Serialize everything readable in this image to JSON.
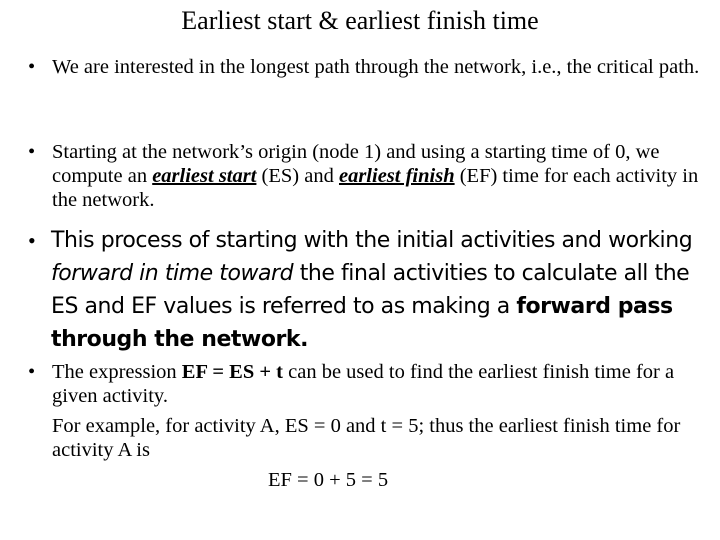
{
  "slide": {
    "title": "Earliest start & earliest finish time",
    "bullet_glyph": "•",
    "bullets": [
      {
        "text": "We are interested in the longest path through the network, i.e., the critical path."
      },
      {
        "part1": "Starting at the network’s origin (node 1) and using a starting time of 0, we compute an ",
        "em1": "earliest start",
        "part2": " (ES) and ",
        "em2": "earliest finish",
        "part3": " (EF) time for each activity in the network."
      },
      {
        "part1": "This process of starting with the initial activities and working ",
        "italic": "forward in time toward",
        "part2": " the final activities to calculate all the ES and EF values is referred to as making a ",
        "bold": "forward pass through the network."
      },
      {
        "part1": "The expression ",
        "bold": "EF = ES + t",
        "part2": " can be used to find the earliest finish time for a given activity.",
        "example": "For example, for activity A, ES = 0 and t = 5; thus the earliest finish time for activity A is",
        "formula": "EF = 0 + 5 = 5"
      }
    ]
  }
}
